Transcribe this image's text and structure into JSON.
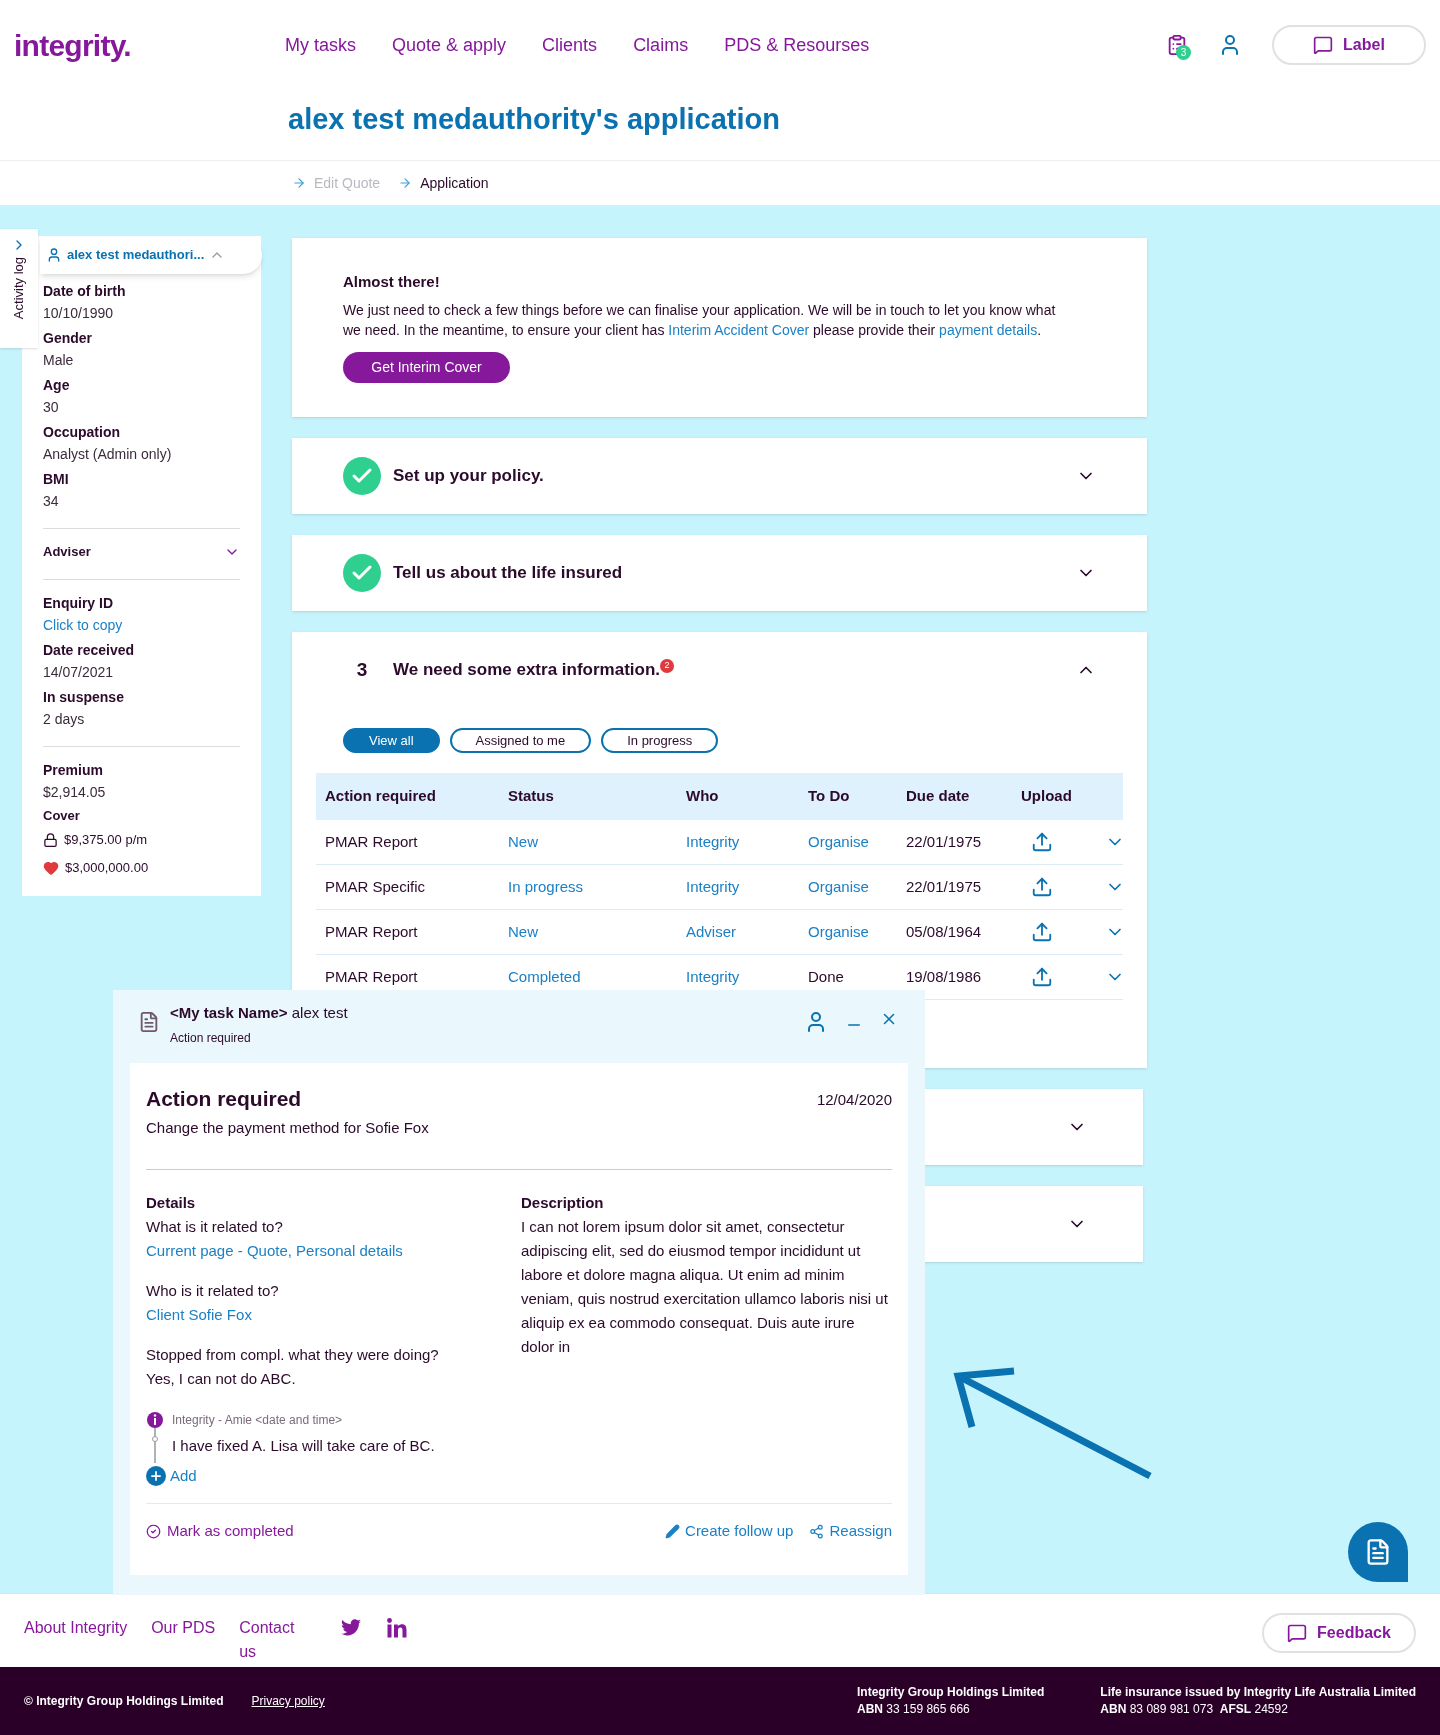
{
  "header": {
    "logo": "integrity.",
    "nav": [
      "My tasks",
      "Quote & apply",
      "Clients",
      "Claims",
      "PDS & Resourses"
    ],
    "tasks_badge": "3",
    "label_button": "Label"
  },
  "page_title": "alex test medauthority's application",
  "breadcrumbs": [
    {
      "label": "Edit Quote",
      "current": false
    },
    {
      "label": "Application",
      "current": true
    }
  ],
  "activity_log": "Activity log",
  "client_panel": {
    "name": "alex test medauthori...",
    "expanded": true,
    "sections": [
      {
        "kind": "fields",
        "fields": [
          {
            "label": "Date of birth",
            "value": "10/10/1990",
            "kind": "text"
          },
          {
            "label": "Gender",
            "value": "Male",
            "kind": "text"
          },
          {
            "label": "Age",
            "value": "30",
            "kind": "text"
          },
          {
            "label": "Occupation",
            "value": "Analyst (Admin only)",
            "kind": "text"
          },
          {
            "label": "BMI",
            "value": "34",
            "kind": "text"
          }
        ]
      },
      {
        "kind": "toggle",
        "label": "Adviser",
        "expanded": false
      },
      {
        "kind": "fields",
        "fields": [
          {
            "label": "Enquiry ID",
            "value": "Click to copy",
            "kind": "link"
          },
          {
            "label": "Date received",
            "value": "14/07/2021",
            "kind": "text"
          },
          {
            "label": "In suspense",
            "value": "2 days",
            "kind": "text"
          }
        ]
      },
      {
        "kind": "fields",
        "fields": [
          {
            "label": "Premium",
            "value": "$2,914.05",
            "kind": "text"
          }
        ]
      },
      {
        "kind": "cover",
        "label": "Cover",
        "values": [
          {
            "kind": "lock",
            "text": "$9,375.00 p/m"
          },
          {
            "kind": "heart",
            "text": "$3,000,000.00"
          }
        ]
      }
    ]
  },
  "notice": {
    "title": "Almost there!",
    "parts": [
      {
        "kind": "text",
        "text": "We just need to check a few things before we can finalise your application. We will be in touch to let you know what we need. In the meantime, to ensure your client has "
      },
      {
        "kind": "link",
        "text": "Interim Accident Cover"
      },
      {
        "kind": "text",
        "text": " please provide their "
      },
      {
        "kind": "link",
        "text": "payment details"
      },
      {
        "kind": "text",
        "text": "."
      }
    ],
    "button": "Get Interim Cover"
  },
  "steps": [
    {
      "kind": "done",
      "title": "Set up your policy.",
      "expanded": false
    },
    {
      "kind": "done",
      "title": "Tell us about the life insured",
      "expanded": false
    },
    {
      "kind": "number",
      "number": "3",
      "title": "We need some extra information.",
      "badge": "2",
      "expanded": true
    }
  ],
  "filters": [
    {
      "label": "View all",
      "selected": true
    },
    {
      "label": "Assigned to me",
      "selected": false
    },
    {
      "label": "In progress",
      "selected": false
    }
  ],
  "table": {
    "columns": [
      "Action required",
      "Status",
      "Who",
      "To Do",
      "Due date",
      "Upload"
    ],
    "rows": [
      {
        "action": "PMAR Report",
        "status": "New",
        "who": "Integrity",
        "todo": "Organise",
        "todo_link": true,
        "due": "22/01/1975",
        "expanded": false
      },
      {
        "action": "PMAR Specific",
        "status": "In progress",
        "who": "Integrity",
        "todo": "Organise",
        "todo_link": true,
        "due": "22/01/1975",
        "expanded": false
      },
      {
        "action": "PMAR Report",
        "status": "New",
        "who": "Adviser",
        "todo": "Organise",
        "todo_link": true,
        "due": "05/08/1964",
        "expanded": false
      },
      {
        "action": "PMAR Report",
        "status": "Completed",
        "who": "Integrity",
        "todo": "Done",
        "todo_link": false,
        "due": "19/08/1986",
        "expanded": false
      }
    ]
  },
  "collapsed_cards": [
    {
      "expanded": false
    },
    {
      "expanded": false
    }
  ],
  "task_panel": {
    "title": "**<My task Name>** alex test",
    "subtitle": "Action required",
    "heading": "Action required",
    "summary": "Change the payment method for Sofie Fox",
    "date": "12/04/2020",
    "details_heading": "Details",
    "details": [
      {
        "question": "What is it related to?",
        "answer": "Current page - Quote, Personal details",
        "kind": "link"
      },
      {
        "question": "Who is it related to?",
        "answer": "Client Sofie Fox",
        "kind": "link"
      },
      {
        "question": "Stopped from compl. what they were doing?",
        "answer": "Yes, I can not do ABC.",
        "kind": "text"
      }
    ],
    "description_heading": "Description",
    "description": "I can not lorem ipsum dolor sit amet, consectetur adipiscing elit, sed do eiusmod tempor incididunt ut labore et dolore magna aliqua. Ut enim ad minim veniam, quis nostrud exercitation ullamco laboris nisi ut aliquip ex ea commodo consequat. Duis aute irure dolor in",
    "comment": {
      "meta": "Integrity - Amie <date and time>",
      "text": "I have fixed A. Lisa will take care of BC."
    },
    "add_label": "Add",
    "actions": [
      {
        "kind": "complete",
        "label": "Mark as completed"
      },
      {
        "kind": "follow_up",
        "label": "Create follow up"
      },
      {
        "kind": "reassign",
        "label": "Reassign"
      }
    ]
  },
  "footer": {
    "links": [
      "About Integrity",
      "Our PDS",
      "Contact us"
    ],
    "feedback": "Feedback",
    "copyright": "© Integrity Group Holdings Limited",
    "privacy": "Privacy policy",
    "entities": [
      {
        "name": "Integrity Group Holdings Limited",
        "details": "**ABN** 33 159 865 666"
      },
      {
        "name": "Life insurance issued by Integrity Life Australia Limited",
        "details": "**ABN** 83 089 981 073  **AFSL** 24592"
      }
    ]
  }
}
